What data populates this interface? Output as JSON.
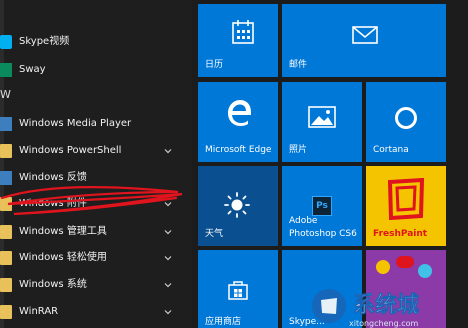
{
  "app_list": {
    "group_letter": "W",
    "items": [
      {
        "label": "Skype视频",
        "icon": "skype-icon"
      },
      {
        "label": "Sway",
        "icon": "sway-icon"
      },
      {
        "label": "Windows Media Player",
        "icon": "media-player-icon"
      },
      {
        "label": "Windows PowerShell",
        "icon": "folder-icon"
      },
      {
        "label": "Windows 反馈",
        "icon": "feedback-icon"
      },
      {
        "label": "Windows 附件",
        "icon": "folder-icon"
      },
      {
        "label": "Windows 管理工具",
        "icon": "folder-icon"
      },
      {
        "label": "Windows 轻松使用",
        "icon": "folder-icon"
      },
      {
        "label": "Windows 系统",
        "icon": "folder-icon"
      },
      {
        "label": "WinRAR",
        "icon": "folder-icon"
      }
    ]
  },
  "tiles": {
    "calendar": {
      "label": "日历",
      "icon": "calendar-icon"
    },
    "mail": {
      "label": "邮件",
      "icon": "mail-icon"
    },
    "edge": {
      "label": "Microsoft Edge",
      "icon": "edge-icon"
    },
    "photos": {
      "label": "照片",
      "icon": "photos-icon"
    },
    "cortana": {
      "label": "Cortana",
      "icon": "cortana-icon"
    },
    "weather": {
      "label": "天气",
      "icon": "weather-sun-icon"
    },
    "photoshop": {
      "label_line1": "Adobe",
      "label_line2": "Photoshop CS6",
      "icon_text": "Ps"
    },
    "freshpaint": {
      "label": "FreshPaint",
      "icon": "freshpaint-frame-icon"
    },
    "store": {
      "label": "应用商店",
      "icon": "store-icon"
    },
    "skype_tile": {
      "label": "Skype..."
    },
    "game": {
      "label": ""
    }
  },
  "colors": {
    "tile_blue": "#0078d7",
    "freshpaint_yellow": "#f5c400",
    "annotation_red": "#e0141d"
  },
  "watermark": {
    "text": "系统城",
    "sub": "xitongcheng.com"
  }
}
